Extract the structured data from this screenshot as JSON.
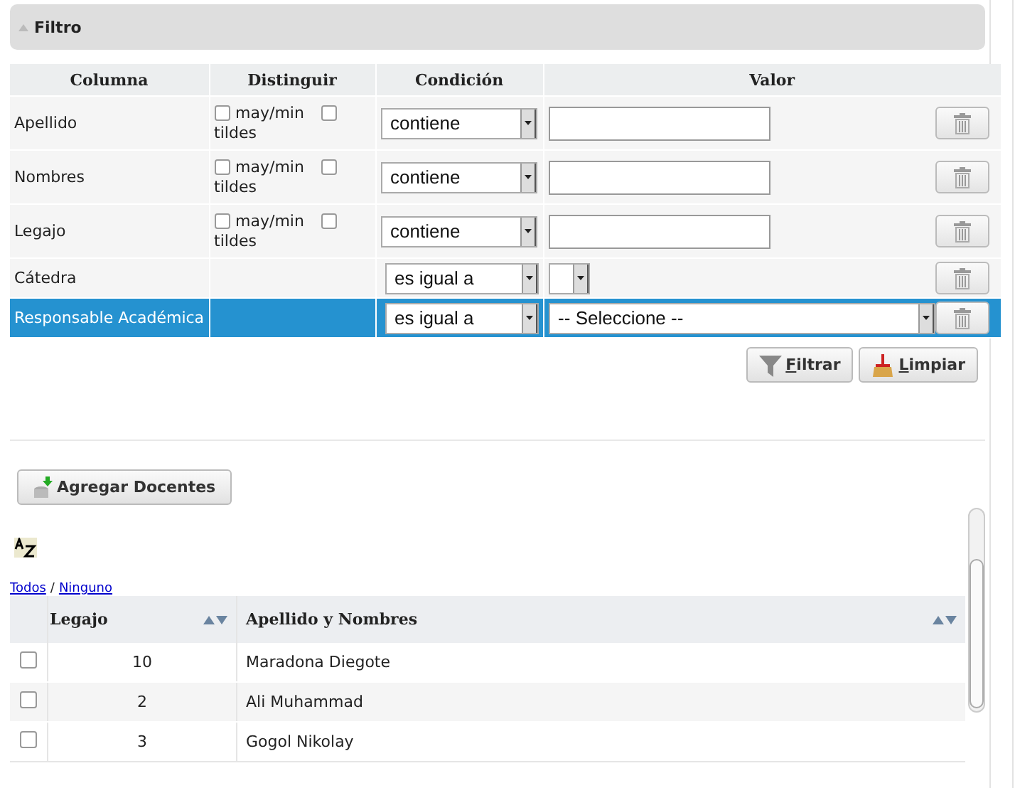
{
  "panel": {
    "title": "Filtro",
    "expanded": true
  },
  "filter_table": {
    "columns": [
      "Columna",
      "Distinguir",
      "Condición",
      "Valor"
    ],
    "rows": [
      {
        "kind": "text",
        "label": "Apellido",
        "case_label": "may/min",
        "accent_label": "tildes",
        "case_checked": false,
        "accent_checked": false,
        "condition": "contiene",
        "selected": false
      },
      {
        "kind": "text",
        "label": "Nombres",
        "case_label": "may/min",
        "accent_label": "tildes",
        "case_checked": false,
        "accent_checked": false,
        "condition": "contiene",
        "selected": false
      },
      {
        "kind": "text",
        "label": "Legajo",
        "case_label": "may/min",
        "accent_label": "tildes",
        "case_checked": false,
        "accent_checked": false,
        "condition": "contiene",
        "selected": false
      },
      {
        "kind": "select",
        "label": "Cátedra",
        "condition": "es igual a",
        "selected": false
      },
      {
        "kind": "select",
        "label": "Responsable Académica",
        "condition": "es igual a",
        "value": "-- Seleccione --",
        "selected": true
      }
    ]
  },
  "actions": [
    {
      "kind": "filter",
      "label": "Filtrar"
    },
    {
      "kind": "clear",
      "label": "Limpiar"
    }
  ],
  "add_button": "Agregar Docentes",
  "select_links": {
    "all": "Todos",
    "separator": "/",
    "none": "Ninguno"
  },
  "results": {
    "columns": [
      {
        "label": "Legajo",
        "sortable": true
      },
      {
        "label": "Apellido y Nombres",
        "sortable": true
      }
    ],
    "rows": [
      {
        "checked": false,
        "legajo": "10",
        "name": "Maradona Diegote"
      },
      {
        "checked": false,
        "legajo": "2",
        "name": "Ali Muhammad"
      },
      {
        "checked": false,
        "legajo": "3",
        "name": "Gogol Nikolay"
      }
    ]
  }
}
